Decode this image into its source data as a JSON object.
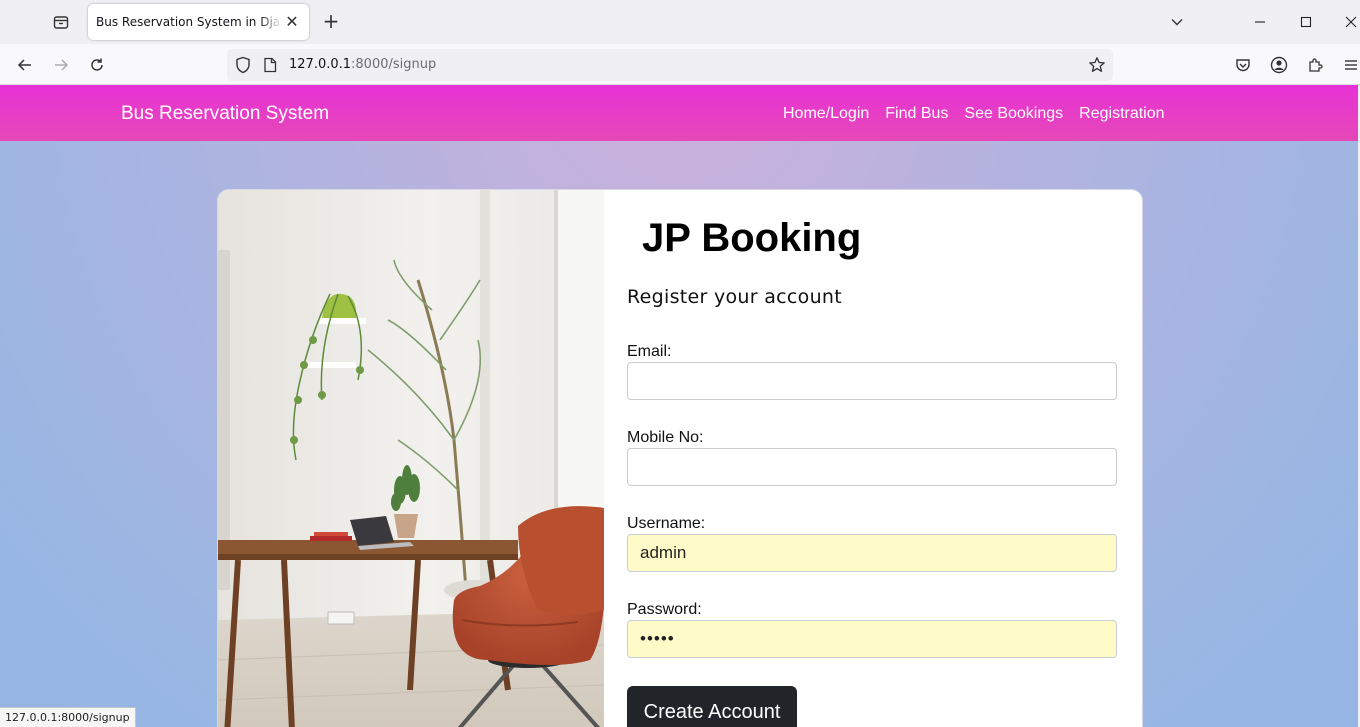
{
  "browser": {
    "tab_title": "Bus Reservation System in Django Pro",
    "url_host": "127.0.0.1",
    "url_path": ":8000/signup",
    "status_url": "127.0.0.1:8000/signup"
  },
  "site": {
    "brand": "Bus Reservation System",
    "nav": [
      "Home/Login",
      "Find Bus",
      "See Bookings",
      "Registration"
    ]
  },
  "form": {
    "heading": "JP Booking",
    "subheading": "Register your account",
    "email_label": "Email:",
    "email_value": "",
    "mobile_label": "Mobile No:",
    "mobile_value": "",
    "username_label": "Username:",
    "username_value": "admin",
    "password_label": "Password:",
    "password_value": "•••••",
    "submit_label": "Create Account"
  },
  "colors": {
    "header_accent": "#e832d8",
    "autofill_bg": "#fffbc9",
    "button_bg": "#212529"
  },
  "icons": [
    "tab-list-icon",
    "close-icon",
    "plus-icon",
    "chevron-down-icon",
    "minimize-icon",
    "maximize-icon",
    "close-window-icon",
    "back-icon",
    "forward-icon",
    "reload-icon",
    "shield-icon",
    "page-icon",
    "star-icon",
    "pocket-icon",
    "account-icon",
    "extensions-icon",
    "menu-icon"
  ]
}
